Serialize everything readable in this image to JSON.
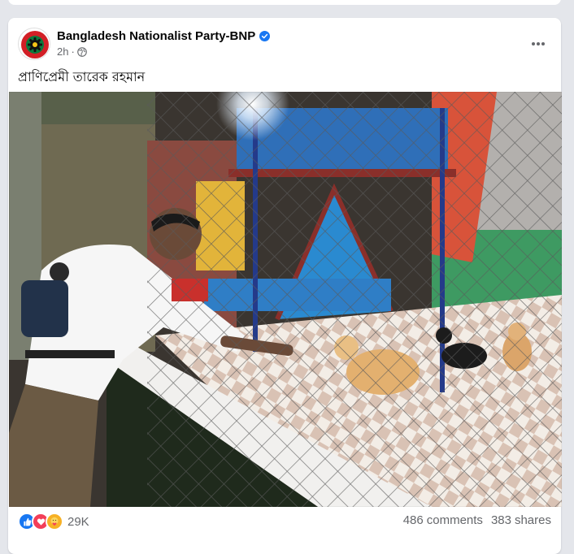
{
  "post": {
    "page_name": "Bangladesh Nationalist Party-BNP",
    "time": "2h",
    "separator": "·",
    "caption": "প্রাণিপ্রেমী তারেক রহমান",
    "reactions": {
      "count": "29K",
      "icons": [
        "like-icon",
        "love-icon",
        "care-icon"
      ]
    },
    "comments": {
      "count": "486",
      "label": "comments"
    },
    "shares": {
      "count": "383",
      "label": "shares"
    }
  },
  "colors": {
    "like": "#1877f2",
    "love": "#f33e58",
    "care": "#f7b125",
    "verified": "#1877f2",
    "meta_text": "#65676b"
  }
}
